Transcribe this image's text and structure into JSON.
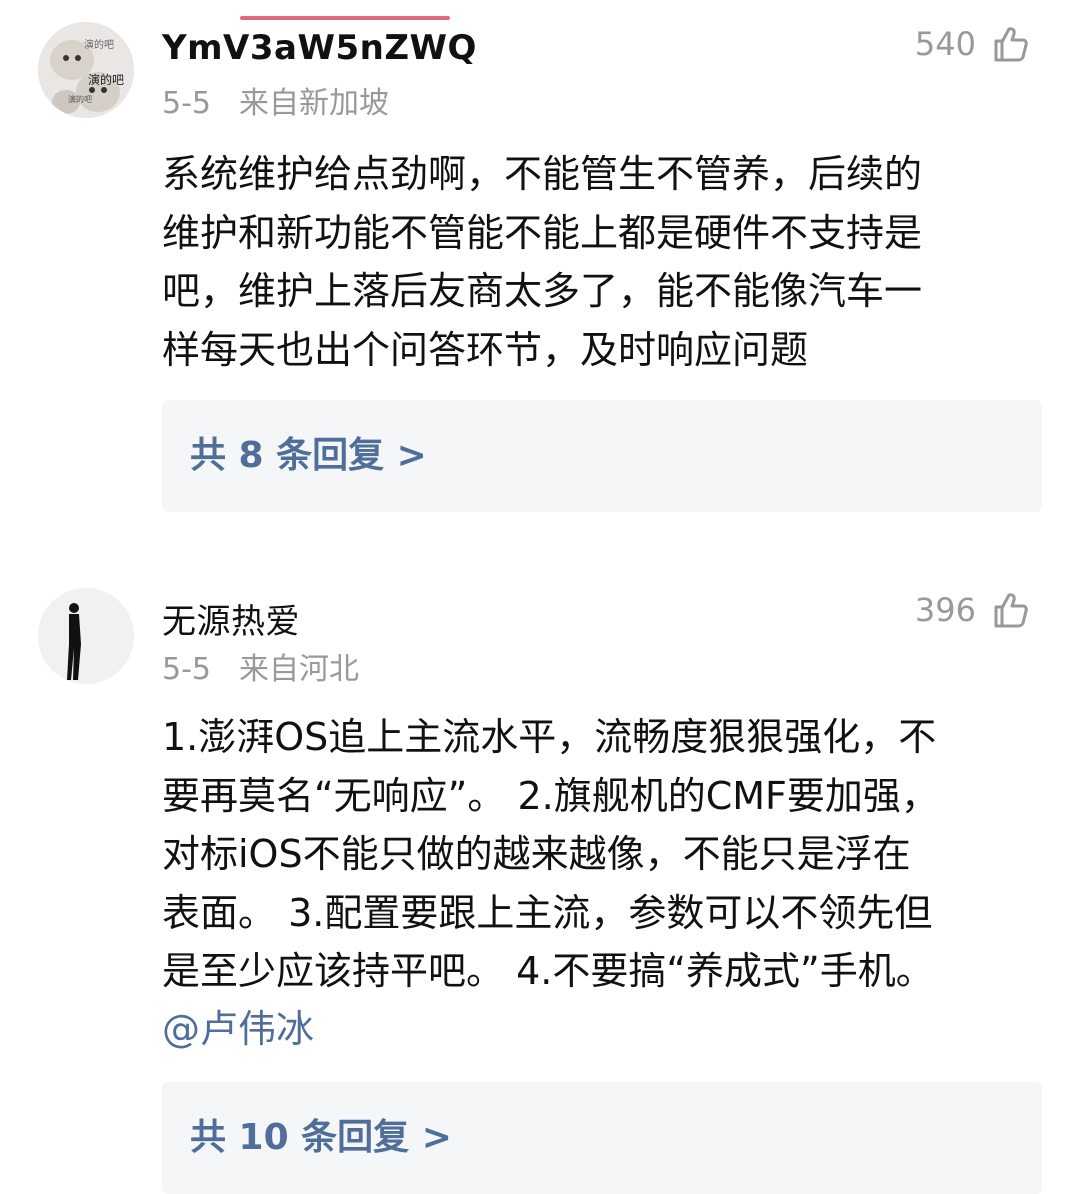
{
  "comments": [
    {
      "username": "YmV3aW5nZWQ",
      "date": "5-5",
      "location": "来自新加坡",
      "likes": "540",
      "avatar_icon": "cat-meme-avatar",
      "avatar_text": [
        "演的吧",
        "演的吧",
        "演的吧"
      ],
      "content": "系统维护给点劲啊，不能管生不管养，后续的\n维护和新功能不管能不能上都是硬件不支持是\n吧，维护上落后友商太多了，能不能像汽车一\n样每天也出个问答环节，及时响应问题",
      "replies": "共 8 条回复 >"
    },
    {
      "username": "无源热爱",
      "date": "5-5",
      "location": "来自河北",
      "likes": "396",
      "avatar_icon": "silhouette-avatar",
      "content": "1.澎湃OS追上主流水平，流畅度狠狠强化，不\n要再莫名“无响应”。 2.旗舰机的CMF要加强，\n对标iOS不能只做的越来越像，不能只是浮在\n表面。 3.配置要跟上主流，参数可以不领先但\n是至少应该持平吧。 4.不要搞“养成式”手机。",
      "mention": "@卢伟冰",
      "replies": "共 10 条回复 >"
    }
  ],
  "colors": {
    "link": "#4f6e99",
    "meta": "#999999",
    "reply_bg": "#f5f6f7"
  },
  "icons": {
    "like": "thumbs-up-icon"
  }
}
